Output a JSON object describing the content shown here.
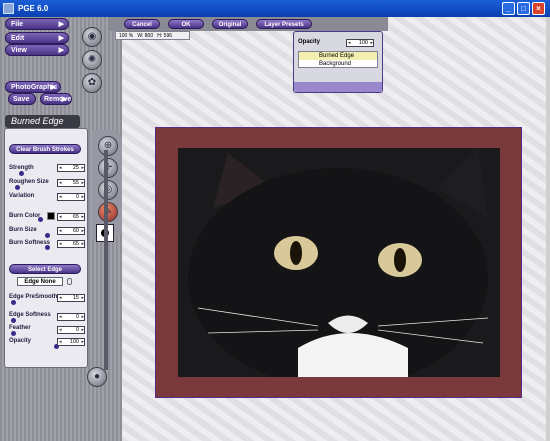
{
  "window": {
    "title": "PGE 6.0",
    "controls": [
      "_",
      "□",
      "×"
    ]
  },
  "menu": {
    "file": "File",
    "edit": "Edit",
    "view": "View",
    "photographic": "PhotoGraphic",
    "save": "Save",
    "remove": "Remove"
  },
  "toolbar": {
    "cancel": "Cancel",
    "ok": "OK",
    "original": "Original",
    "layer_presets": "Layer Presets"
  },
  "info": {
    "zoom": "100 %",
    "width": "W: 800",
    "height": "H: 596"
  },
  "panel": {
    "title": "Burned Edge",
    "clear_brush": "Clear Brush Strokes",
    "strength": {
      "label": "Strength",
      "value": "25"
    },
    "roughen": {
      "label": "Roughen Size",
      "value": "55"
    },
    "variation": {
      "label": "Variation",
      "value": "0"
    },
    "burn_color": {
      "label": "Burn Color",
      "value": "65"
    },
    "burn_size": {
      "label": "Burn Size",
      "value": "60"
    },
    "burn_softness": {
      "label": "Burn Softness",
      "value": "65"
    },
    "select_edge": "Select Edge",
    "edge_none": "Edge None",
    "edge_presmooth": {
      "label": "Edge PreSmooth",
      "value": "15"
    },
    "edge_softness": {
      "label": "Edge Softness",
      "value": "0"
    },
    "feather": {
      "label": "Feather",
      "value": "0"
    },
    "opacity": {
      "label": "Opacity",
      "value": "100"
    }
  },
  "layers": {
    "opacity_label": "Opacity",
    "opacity_value": "100",
    "items": [
      {
        "label": "Burned Edge",
        "selected": true
      },
      {
        "label": "Background",
        "selected": false
      }
    ]
  },
  "colors": {
    "accent": "#4a3486",
    "frame": "#7a3a3c"
  }
}
